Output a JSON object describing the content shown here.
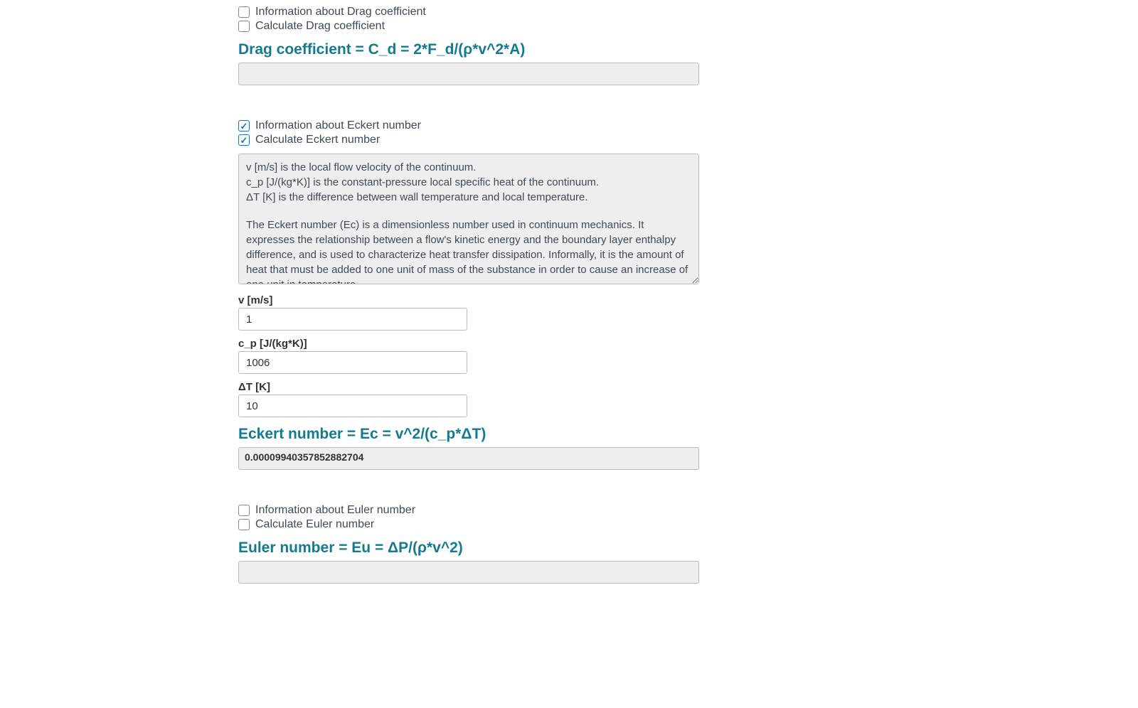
{
  "drag": {
    "info_label": "Information about Drag coefficient",
    "calc_label": "Calculate Drag coefficient",
    "info_checked": false,
    "calc_checked": false,
    "formula": "Drag coefficient = C_d = 2*F_d/(ρ*v^2*A)",
    "result": ""
  },
  "eckert": {
    "info_label": "Information about Eckert number",
    "calc_label": "Calculate Eckert number",
    "info_checked": true,
    "calc_checked": true,
    "description_line1": "v [m/s] is the local flow velocity of the continuum.",
    "description_line2": "c_p [J/(kg*K)] is the constant-pressure local specific heat of the continuum.",
    "description_line3": "ΔT [K] is the difference between wall temperature and local temperature.",
    "description_para": "The Eckert number (Ec) is a dimensionless number used in continuum mechanics. It expresses the relationship between a flow's kinetic energy and the boundary layer enthalpy difference, and is used to characterize heat transfer dissipation. Informally, it is the amount of heat that must be added to one unit of mass of the substance in order to cause an increase of one unit in temperature.",
    "field_v_label": "v [m/s]",
    "field_v_value": "1",
    "field_cp_label": "c_p [J/(kg*K)]",
    "field_cp_value": "1006",
    "field_dt_label": "ΔT [K]",
    "field_dt_value": "10",
    "formula": "Eckert number = Ec = v^2/(c_p*ΔT)",
    "result": "0.00009940357852882704"
  },
  "euler": {
    "info_label": "Information about Euler number",
    "calc_label": "Calculate Euler number",
    "info_checked": false,
    "calc_checked": false,
    "formula": "Euler number = Eu = ΔP/(ρ*v^2)",
    "result": ""
  }
}
